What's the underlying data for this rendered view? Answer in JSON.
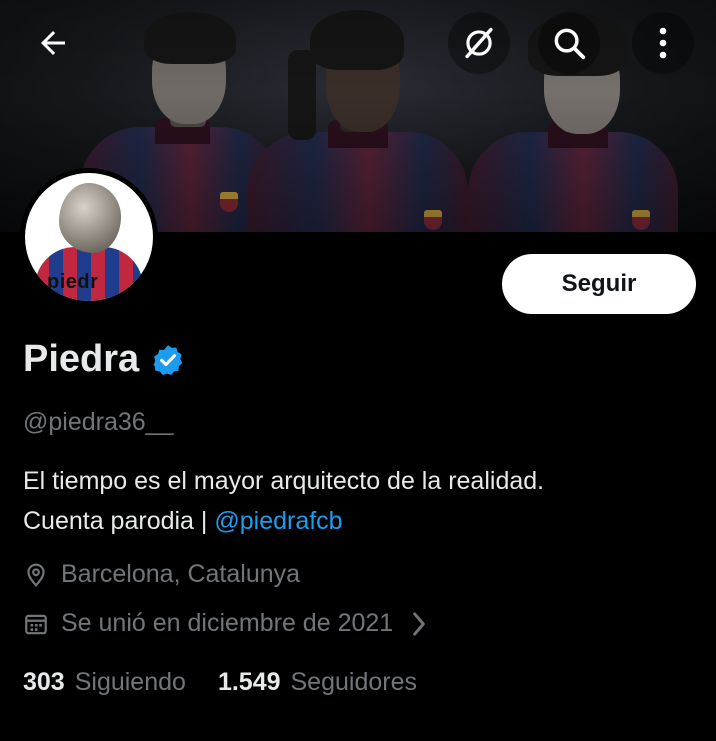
{
  "header": {
    "back_icon": "arrow-left-icon",
    "grok_icon": "grok-icon",
    "search_icon": "search-icon",
    "more_icon": "more-vertical-icon"
  },
  "profile": {
    "avatar_text": "piedr",
    "name": "Piedra",
    "verified_icon": "verified-badge-icon",
    "handle": "@piedra36__",
    "follow_label": "Seguir",
    "bio_line1": "El tiempo es el mayor arquitecto de la realidad.",
    "bio_line2_prefix": "Cuenta parodia |",
    "bio_link": "@piedrafcb",
    "location_icon": "location-pin-icon",
    "location": "Barcelona, Catalunya",
    "joined_icon": "calendar-icon",
    "joined": "Se unió en diciembre de 2021",
    "following_count": "303",
    "following_label": "Siguiendo",
    "followers_count": "1.549",
    "followers_label": "Seguidores"
  },
  "colors": {
    "background": "#000000",
    "text_primary": "#e7e9ea",
    "text_secondary": "#71767b",
    "link": "#1d9bf0",
    "verified": "#1d9bf0"
  }
}
